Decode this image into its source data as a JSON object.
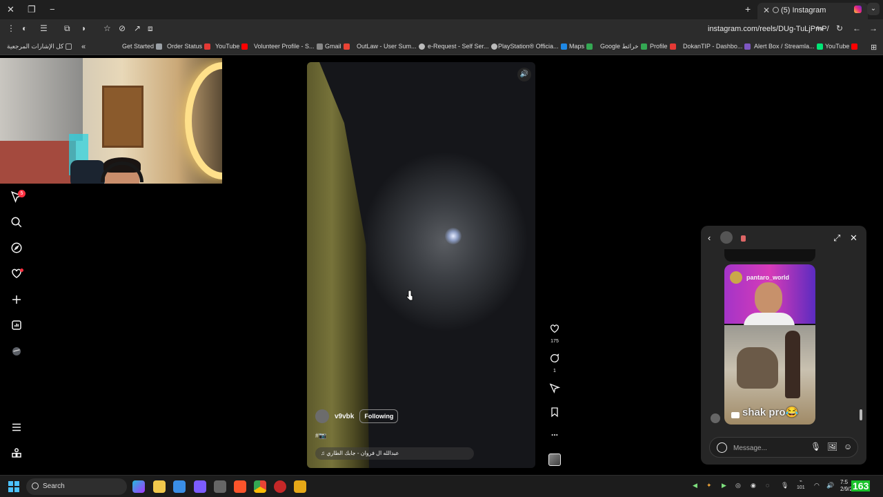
{
  "browser": {
    "tab_title": "(5) Instagram",
    "url": "instagram.com/reels/DUg-TuLjPmP/",
    "bookmarks": [
      {
        "label": "كل الإشارات المرجعية",
        "color": "#888"
      },
      {
        "label": "Get Started",
        "color": "#9aa0a6"
      },
      {
        "label": "Order Status",
        "color": "#e53935"
      },
      {
        "label": "YouTube",
        "color": "#ff0000"
      },
      {
        "label": "Volunteer Profile - S...",
        "color": "#888"
      },
      {
        "label": "Gmail",
        "color": "#ea4335"
      },
      {
        "label": "OutLaw - User Sum...",
        "color": "#bbbbbb"
      },
      {
        "label": "e-Request - Self Ser...",
        "color": "#bbbbbb"
      },
      {
        "label": "PlayStation® Officia...",
        "color": "#1e88e5"
      },
      {
        "label": "Maps",
        "color": "#34a853"
      },
      {
        "label": "Google خرائط",
        "color": "#34a853"
      },
      {
        "label": "Profile",
        "color": "#e53935"
      },
      {
        "label": "DokanTIP - Dashbo...",
        "color": "#7e57c2"
      },
      {
        "label": "Alert Box / Streamla...",
        "color": "#00e676"
      },
      {
        "label": "YouTube",
        "color": "#ff0000"
      }
    ]
  },
  "sidebar": {
    "notification_badge": "5",
    "icons": [
      "reels-icon",
      "search-icon",
      "explore-icon",
      "heart-icon",
      "create-icon",
      "dashboard-icon",
      "profile-avatar",
      "menu-icon",
      "more-icon"
    ]
  },
  "reel": {
    "username": "v9vbk",
    "follow_label": "Following",
    "caption": "#📷",
    "audio": "عبدالله ال فروان - جابك الطاري",
    "likes": "175",
    "comments": "1",
    "more": "..."
  },
  "chat": {
    "shared_username": "pantaro_world",
    "shared_caption": "shak pro😂",
    "message_placeholder": "Message..."
  },
  "taskbar": {
    "search_label": "Search",
    "clock_time": "7:5",
    "clock_date": "2/9/2026",
    "fps": "163",
    "tray_value": "101",
    "accent": "#4cc2ff"
  }
}
